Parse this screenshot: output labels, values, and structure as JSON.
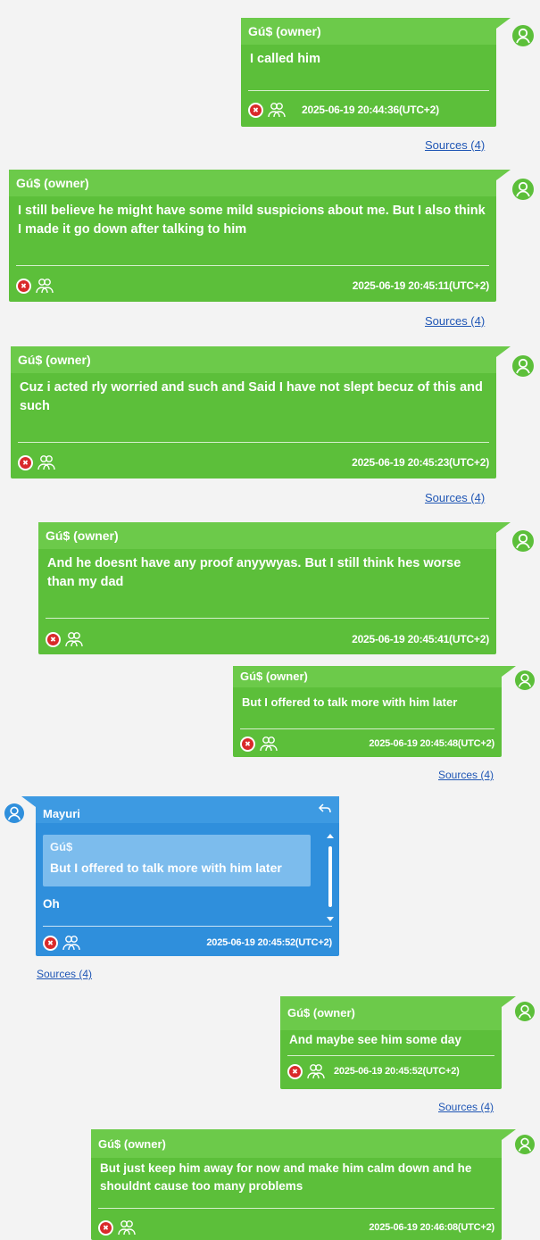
{
  "colors": {
    "owner_bubble": "#5cbf3a",
    "owner_header": "#6cca4a",
    "other_bubble": "#2f8fdc",
    "link": "#1f56b5",
    "delete": "#d92a2a"
  },
  "icons": {
    "avatar": "user-avatar-icon",
    "delete": "delete-icon",
    "recipients": "group-icon",
    "reply": "reply-icon"
  },
  "messages": [
    {
      "sender": "Gú$ (owner)",
      "text": "I called him",
      "timestamp": "2025-06-19 20:44:36(UTC+2)",
      "sources": "Sources (4)"
    },
    {
      "sender": "Gú$ (owner)",
      "text": "I still believe he might have some mild suspicions about me. But I also think I made it go down after talking to him",
      "timestamp": "2025-06-19 20:45:11(UTC+2)",
      "sources": "Sources (4)"
    },
    {
      "sender": "Gú$ (owner)",
      "text": "Cuz i acted rly worried and such and Said I have not slept becuz of this and such",
      "timestamp": "2025-06-19 20:45:23(UTC+2)",
      "sources": "Sources (4)"
    },
    {
      "sender": "Gú$ (owner)",
      "text": "And he doesnt have any proof anyywyas. But I still think hes worse than my dad",
      "timestamp": "2025-06-19 20:45:41(UTC+2)"
    },
    {
      "sender": "Gú$ (owner)",
      "text": "But I offered to talk more with him later",
      "timestamp": "2025-06-19 20:45:48(UTC+2)",
      "sources": "Sources (4)"
    },
    {
      "sender": "Mayuri",
      "quote_author": "Gú$",
      "quote_text": "But I offered to talk more with him later",
      "text": "Oh",
      "timestamp": "2025-06-19 20:45:52(UTC+2)",
      "sources": "Sources (4)"
    },
    {
      "sender": "Gú$ (owner)",
      "text": "And maybe see him some day",
      "timestamp": "2025-06-19 20:45:52(UTC+2)",
      "sources": "Sources (4)"
    },
    {
      "sender": "Gú$ (owner)",
      "text": "But just keep him away for now and make him calm down and he shouldnt cause too many problems",
      "timestamp": "2025-06-19 20:46:08(UTC+2)"
    }
  ]
}
